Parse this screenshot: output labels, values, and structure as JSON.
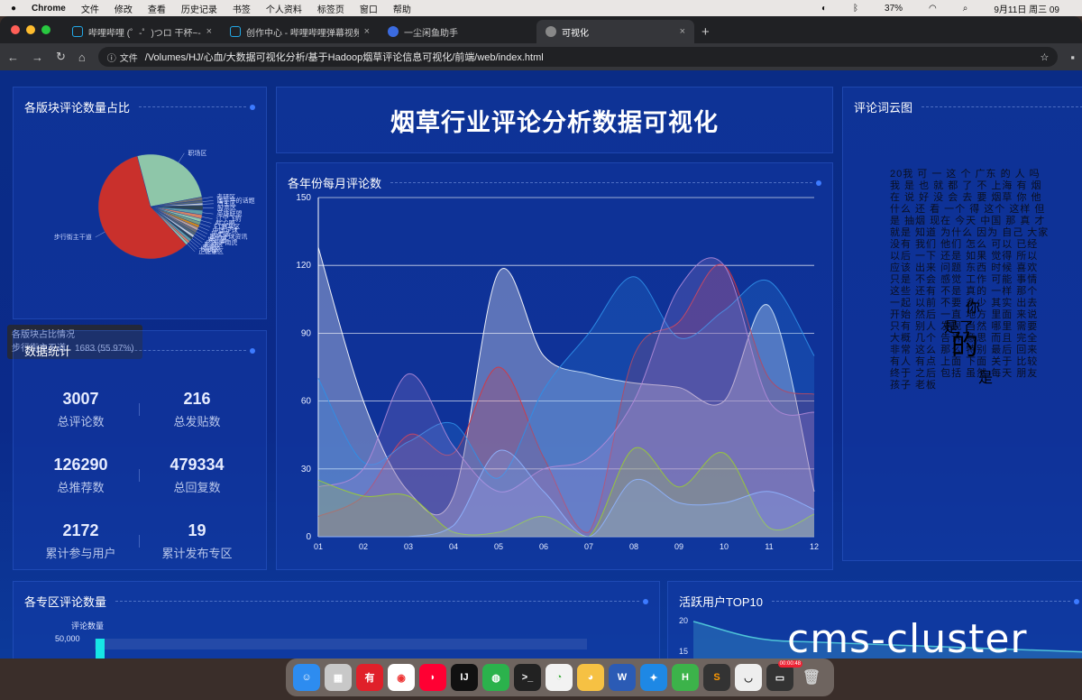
{
  "menubar": {
    "apple": "",
    "items": [
      "Chrome",
      "文件",
      "修改",
      "查看",
      "历史记录",
      "书签",
      "个人资料",
      "标签页",
      "窗口",
      "帮助"
    ],
    "battery": "37%",
    "datetime": "9月11日 周三 09"
  },
  "browser": {
    "tabs": [
      {
        "title": "哔哩哔哩 (゜-゜)つロ 干杯~-bi",
        "icon": "bilibili-icon",
        "color": "#22a8e6",
        "active": false
      },
      {
        "title": "创作中心 - 哔哩哔哩弹幕视频网",
        "icon": "bilibili-icon",
        "color": "#22a8e6",
        "active": false
      },
      {
        "title": "一尘闲鱼助手",
        "icon": "puzzle-icon",
        "color": "#3b6be0",
        "active": false
      },
      {
        "title": "可视化",
        "icon": "globe-icon",
        "color": "#aaaaaa",
        "active": true
      }
    ],
    "new_tab": "+",
    "url_chip": "文件",
    "url": "/Volumes/HJ/心血/大数据可视化分析/基于Hadoop烟草评论信息可视化/前端/web/index.html"
  },
  "dashboard": {
    "title": "烟草行业评论分析数据可视化",
    "pie_title": "各版块评论数量占比",
    "line_title": "各年份每月评论数",
    "cloud_title": "评论词云图",
    "stats_title": "数据统计",
    "bar_title": "各专区评论数量",
    "top_title": "活跃用户TOP10",
    "stats": [
      {
        "value": "3007",
        "label": "总评论数"
      },
      {
        "value": "216",
        "label": "总发贴数"
      },
      {
        "value": "126290",
        "label": "总推荐数"
      },
      {
        "value": "479334",
        "label": "总回复数"
      },
      {
        "value": "2172",
        "label": "累计参与用户"
      },
      {
        "value": "19",
        "label": "累计发布专区"
      }
    ],
    "tooltip": {
      "title": "各版块占比情况",
      "line": "步行街主干道：1683 (55.97%)"
    },
    "bar_legend": "评论数量",
    "bar_y_tick": "50,000",
    "top_y_ticks": [
      "20",
      "15"
    ],
    "cloud_words": "20我 可 一 这 个 广东 的 人 吗 我 是 也 就 都 了 不 上海 有 烟 在 说 好 没 会 去 要 烟草 你 他 什么 还 看 一个 得 这个 这样 但是 抽烟 现在 今天 中国 那 真 才 就是 知道 为什么 因为 自己 大家 没有 我们 他们 怎么 可以 已经 以后 一下 还是 如果 觉得 所以 应该 出来 问题 东西 时候 喜欢 只是 不会 感觉 工作 可能 事情 这些 还有 不是 真的 一样 那个 一起 以前 不要 多少 其实 出去 开始 然后 一直 地方 里面 来说 只有 别人 发现 当然 哪里 需要 大概 几个 告诉 意思 而且 完全 非常 这么 那么 特别 最后 回来 有人 有点 上面 下面 关于 比较 终于 之后 包括 虽然 每天 朋友 孩子 老板 ",
    "cloud_big": "的",
    "cloud_mid": [
      "你",
      "是了",
      "是"
    ],
    "watermark": "cms-cluster",
    "dock_recording": "00:00:48"
  },
  "chart_data": [
    {
      "type": "pie",
      "title": "各版块评论数量占比",
      "slices": [
        {
          "label": "步行街主干道",
          "value": 1683,
          "color": "#c9302c"
        },
        {
          "label": "职场区",
          "value": 760,
          "color": "#8ec6a9"
        },
        {
          "label": "考研区",
          "value": 30,
          "color": "#6e7074"
        },
        {
          "label": "国乎乎的话题",
          "value": 25,
          "color": "#546570"
        },
        {
          "label": "汽车区",
          "value": 20,
          "color": "#c4ccd3"
        },
        {
          "label": "股票区",
          "value": 45,
          "color": "#2f4554"
        },
        {
          "label": "英雄联盟",
          "value": 40,
          "color": "#61a0a8"
        },
        {
          "label": "辽宁飞豹",
          "value": 35,
          "color": "#d48265"
        },
        {
          "label": "ACG圈",
          "value": 30,
          "color": "#91c7ae"
        },
        {
          "label": "F1赛车区",
          "value": 28,
          "color": "#749f83"
        },
        {
          "label": "中国足球",
          "value": 27,
          "color": "#ca8622"
        },
        {
          "label": "历史区",
          "value": 26,
          "color": "#bda29a"
        },
        {
          "label": "国际足球资讯",
          "value": 25,
          "color": "#6e7074"
        },
        {
          "label": "娱乐圈",
          "value": 24,
          "color": "#546570"
        },
        {
          "label": "广东华南虎",
          "value": 23,
          "color": "#c4ccd3"
        },
        {
          "label": "影视区",
          "value": 22,
          "color": "#2f4554"
        },
        {
          "label": "恋爱区",
          "value": 22,
          "color": "#61a0a8"
        },
        {
          "label": "校园区",
          "value": 21,
          "color": "#d48265"
        },
        {
          "label": "正能量区",
          "value": 21,
          "color": "#91c7ae"
        }
      ]
    },
    {
      "type": "area",
      "title": "各年份每月评论数",
      "categories": [
        "01",
        "02",
        "03",
        "04",
        "05",
        "06",
        "07",
        "08",
        "09",
        "10",
        "11",
        "12"
      ],
      "y_ticks": [
        0,
        30,
        60,
        90,
        120,
        150
      ],
      "ylim": [
        0,
        150
      ],
      "series": [
        {
          "color": "#ffffff",
          "values": [
            128,
            60,
            20,
            18,
            117,
            80,
            72,
            68,
            66,
            60,
            102,
            20
          ]
        },
        {
          "color": "#d9363e",
          "values": [
            9,
            18,
            45,
            37,
            75,
            35,
            2,
            80,
            95,
            120,
            70,
            63
          ]
        },
        {
          "color": "#2f8fe8",
          "values": [
            70,
            33,
            42,
            50,
            26,
            65,
            90,
            115,
            88,
            100,
            113,
            80
          ]
        },
        {
          "color": "#b08ad8",
          "values": [
            22,
            30,
            72,
            40,
            20,
            30,
            35,
            60,
            110,
            120,
            60,
            55
          ]
        },
        {
          "color": "#9acd32",
          "values": [
            25,
            18,
            18,
            2,
            2,
            9,
            0,
            39,
            22,
            37,
            4,
            10
          ]
        },
        {
          "color": "#8fb4ff",
          "values": [
            0,
            0,
            0,
            5,
            38,
            20,
            0,
            25,
            15,
            15,
            20,
            12
          ]
        }
      ]
    }
  ]
}
